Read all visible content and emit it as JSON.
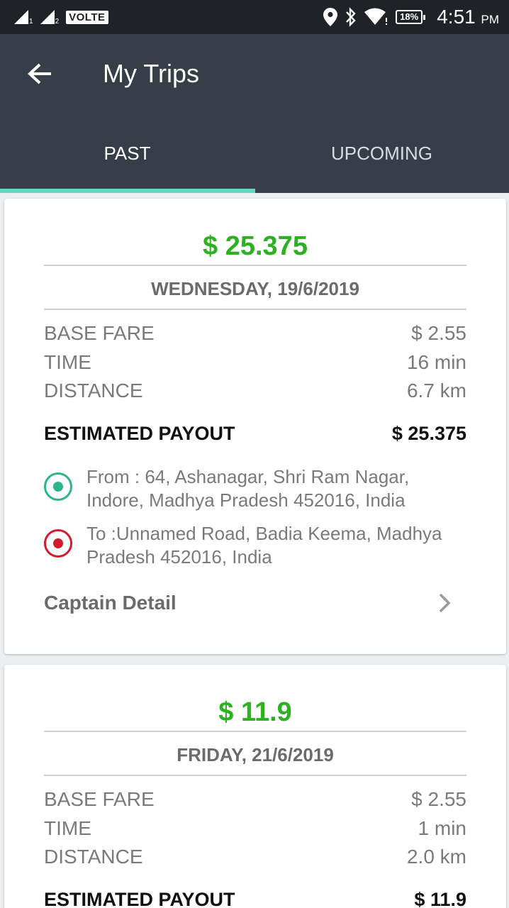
{
  "status_bar": {
    "sim1": "1",
    "sim2": "2",
    "volte": "VOLTE",
    "battery": "18%",
    "time": "4:51",
    "ampm": "PM",
    "icons": [
      "signal-icon",
      "location-icon",
      "bluetooth-icon",
      "wifi-icon",
      "battery-icon"
    ]
  },
  "header": {
    "title": "My Trips",
    "back_icon": "arrow-left-icon"
  },
  "tabs": [
    {
      "label": "PAST",
      "active": true
    },
    {
      "label": "UPCOMING",
      "active": false
    }
  ],
  "colors": {
    "appbar": "#373e48",
    "tab_indicator": "#5fd9c1",
    "amount_green": "#2db022",
    "from_dot": "#2eb38a",
    "to_dot": "#d11a2a"
  },
  "trips": [
    {
      "amount": "$ 25.375",
      "date": "WEDNESDAY, 19/6/2019",
      "base_fare_label": "BASE FARE",
      "base_fare": "$ 2.55",
      "time_label": "TIME",
      "time": "16 min",
      "distance_label": "DISTANCE",
      "distance": "6.7 km",
      "payout_label": "ESTIMATED PAYOUT",
      "payout": "$ 25.375",
      "from_line1": "From : 64, Ashanagar, Shri Ram Nagar,",
      "from_line2": "Indore, Madhya Pradesh 452016, India",
      "to_line1": "To :Unnamed Road, Badia Keema, Madhya",
      "to_line2": "Pradesh 452016, India",
      "captain_label": "Captain Detail"
    },
    {
      "amount": "$ 11.9",
      "date": "FRIDAY, 21/6/2019",
      "base_fare_label": "BASE FARE",
      "base_fare": "$ 2.55",
      "time_label": "TIME",
      "time": "1 min",
      "distance_label": "DISTANCE",
      "distance": "2.0 km",
      "payout_label": "ESTIMATED PAYOUT",
      "payout": "$ 11.9"
    }
  ]
}
